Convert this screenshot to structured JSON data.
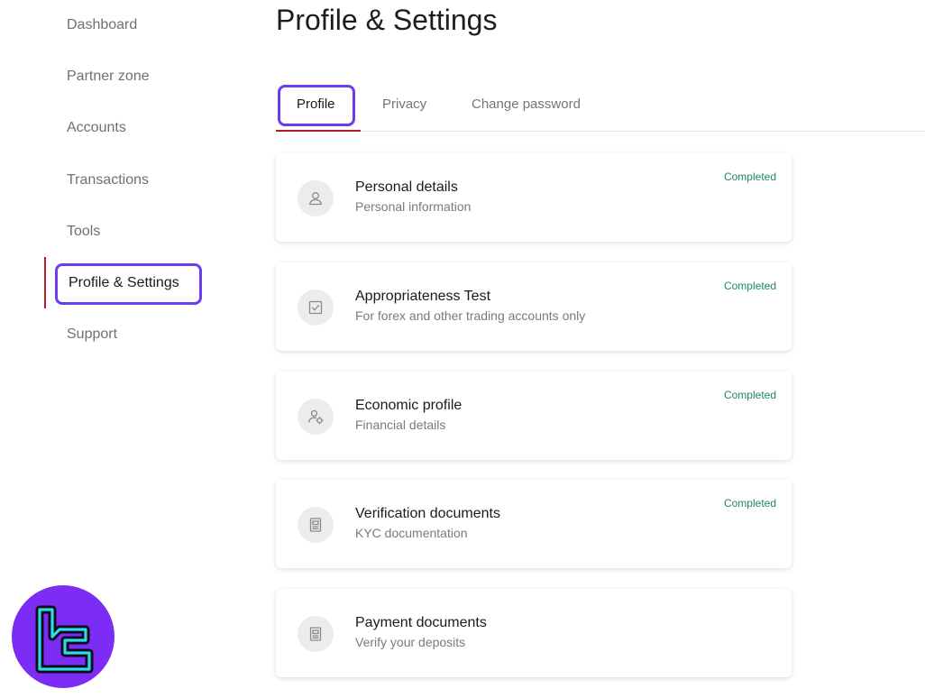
{
  "sidebar": {
    "items": [
      {
        "label": "Dashboard"
      },
      {
        "label": "Partner zone"
      },
      {
        "label": "Accounts"
      },
      {
        "label": "Transactions"
      },
      {
        "label": "Tools"
      },
      {
        "label": "Profile & Settings",
        "active": true
      },
      {
        "label": "Support"
      }
    ]
  },
  "page": {
    "title": "Profile & Settings"
  },
  "tabs": [
    {
      "label": "Profile",
      "active": true
    },
    {
      "label": "Privacy"
    },
    {
      "label": "Change password"
    }
  ],
  "cards": [
    {
      "title": "Personal details",
      "subtitle": "Personal information",
      "status": "Completed",
      "icon": "user-icon"
    },
    {
      "title": "Appropriateness Test",
      "subtitle": "For forex and other trading accounts only",
      "status": "Completed",
      "icon": "checkbox-icon"
    },
    {
      "title": "Economic profile",
      "subtitle": "Financial details",
      "status": "Completed",
      "icon": "user-settings-icon"
    },
    {
      "title": "Verification documents",
      "subtitle": "KYC documentation",
      "status": "Completed",
      "icon": "document-icon"
    },
    {
      "title": "Payment documents",
      "subtitle": "Verify your deposits",
      "status": "",
      "icon": "document-icon"
    }
  ],
  "colors": {
    "accent_red": "#b01e2a",
    "highlight_purple": "#6a3df0",
    "status_green": "#1e8a60",
    "logo_purple": "#7c2cf5",
    "logo_cyan": "#2fd9e6"
  }
}
